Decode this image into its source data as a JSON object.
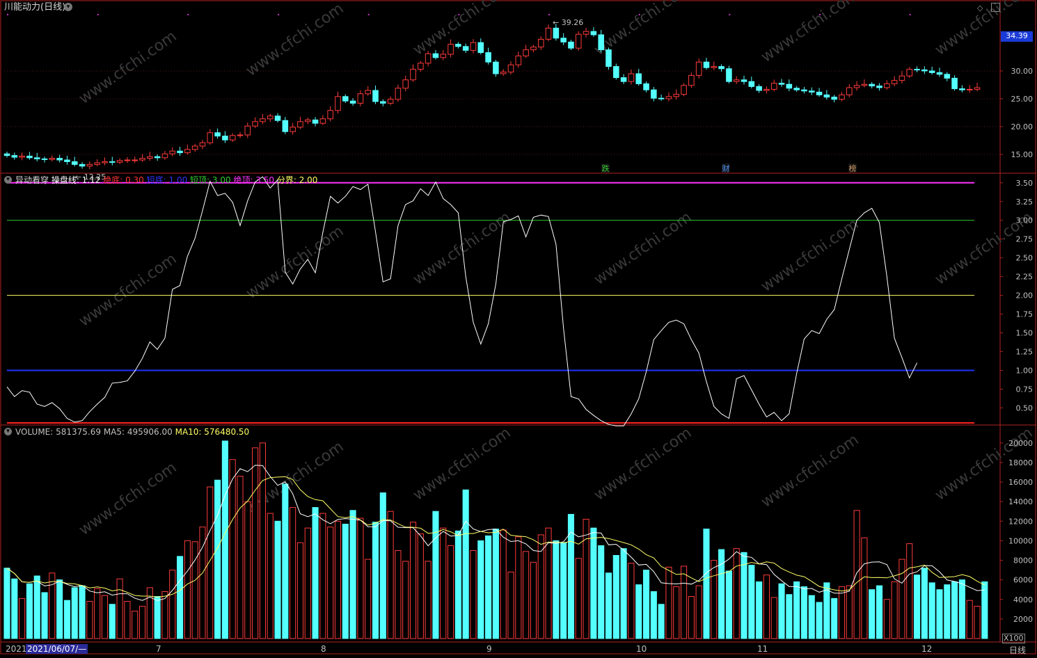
{
  "header": {
    "title": "川能动力(日线)",
    "current_price_tag": "34.39",
    "right_icons": [
      "diamond-icon",
      "restore-window-icon"
    ]
  },
  "price_panel": {
    "high_label": "39.26",
    "low_label": "12.25",
    "y_ticks": [
      "30.00",
      "25.00",
      "20.00",
      "15.00"
    ],
    "markers": [
      {
        "text": "跌",
        "color": "#33cc33"
      },
      {
        "text": "财",
        "color": "#5599ff"
      },
      {
        "text": "榜",
        "color": "#cc9966"
      }
    ]
  },
  "indicator_panel": {
    "name": "异动看穿",
    "params": [
      {
        "label": "操盘线: 1.12",
        "color": "#ffffff"
      },
      {
        "label": "绝底: 0.30",
        "color": "#ff3333"
      },
      {
        "label": "短底: 1.00",
        "color": "#3333ff"
      },
      {
        "label": "短顶: 3.00",
        "color": "#33cc33"
      },
      {
        "label": "绝顶: 3.50",
        "color": "#ff33ff"
      },
      {
        "label": "分界: 2.00",
        "color": "#ffff66"
      }
    ],
    "y_ticks": [
      "3.50",
      "3.25",
      "3.00",
      "2.75",
      "2.50",
      "2.25",
      "2.00",
      "1.75",
      "1.50",
      "1.25",
      "1.00",
      "0.75",
      "0.50"
    ]
  },
  "volume_panel": {
    "labels": [
      {
        "label": "VOLUME: 581375.69",
        "color": "#c0c0c0"
      },
      {
        "label": "MA5: 495906.00",
        "color": "#c0c0c0"
      },
      {
        "label": "MA10: 576480.50",
        "color": "#ffff66"
      }
    ],
    "y_ticks": [
      "20000",
      "18000",
      "16000",
      "14000",
      "12000",
      "10000",
      "8000",
      "6000",
      "4000",
      "2000"
    ],
    "unit": "X100"
  },
  "x_axis": {
    "labels": [
      "2021",
      "2021/06/07/—",
      "7",
      "8",
      "9",
      "10",
      "11",
      "12"
    ],
    "period": "日线"
  },
  "watermark": "www.cfchi.com",
  "colors": {
    "up": "#ff3b3b",
    "down": "#54ffff",
    "frame": "#b22222",
    "bg": "#000000"
  },
  "chart_data": [
    {
      "type": "candlestick",
      "title": "川能动力(日线)",
      "ylim": [
        12,
        40
      ],
      "series": [
        {
          "name": "close",
          "values": [
            14.8,
            14.5,
            14.7,
            14.4,
            14.2,
            14.1,
            14.3,
            14.0,
            13.7,
            13.2,
            12.9,
            13.2,
            13.5,
            13.7,
            13.6,
            13.9,
            14.0,
            14.0,
            14.3,
            14.6,
            14.4,
            15.1,
            15.6,
            15.3,
            15.9,
            16.5,
            17.1,
            18.9,
            18.3,
            17.6,
            18.4,
            18.5,
            20.1,
            20.9,
            21.4,
            21.9,
            21.1,
            19.1,
            19.9,
            20.9,
            21.2,
            20.6,
            21.4,
            22.9,
            25.4,
            24.6,
            24.2,
            25.9,
            26.5,
            24.5,
            24.2,
            24.9,
            26.9,
            28.4,
            30.3,
            31.4,
            33.1,
            32.4,
            33.0,
            34.8,
            34.4,
            33.7,
            35.1,
            33.3,
            31.6,
            29.5,
            29.8,
            31.1,
            32.7,
            33.8,
            34.3,
            35.7,
            37.7,
            35.9,
            35.2,
            34.1,
            36.6,
            37.1,
            36.5,
            33.8,
            30.8,
            28.8,
            28.1,
            29.5,
            27.7,
            26.6,
            25.1,
            25.0,
            25.4,
            25.8,
            27.4,
            29.2,
            31.6,
            30.6,
            30.8,
            30.4,
            28.1,
            28.4,
            28.1,
            27.2,
            26.5,
            26.7,
            27.8,
            27.6,
            26.9,
            26.6,
            26.4,
            26.2,
            25.7,
            25.3,
            24.9,
            25.7,
            27.0,
            27.4,
            27.6,
            27.3,
            27.0,
            27.7,
            28.3,
            29.1,
            30.3,
            30.2,
            30.0,
            29.7,
            29.4,
            28.7,
            26.8,
            26.6,
            26.7,
            27.0
          ]
        }
      ]
    },
    {
      "type": "line",
      "title": "异动看穿",
      "ylim": [
        0.3,
        3.6
      ],
      "series": [
        {
          "name": "操盘线",
          "values": [
            0.78,
            0.65,
            0.73,
            0.71,
            0.55,
            0.52,
            0.57,
            0.49,
            0.36,
            0.31,
            0.33,
            0.45,
            0.55,
            0.64,
            0.83,
            0.84,
            0.86,
            0.99,
            1.16,
            1.38,
            1.28,
            1.43,
            2.08,
            2.13,
            2.52,
            2.76,
            3.13,
            3.52,
            3.33,
            3.36,
            3.24,
            2.93,
            3.26,
            3.51,
            3.58,
            3.43,
            3.54,
            2.31,
            2.15,
            2.35,
            2.48,
            2.3,
            2.84,
            3.32,
            3.23,
            3.32,
            3.45,
            3.41,
            3.48,
            2.85,
            2.18,
            2.22,
            2.93,
            3.21,
            3.26,
            3.42,
            3.33,
            3.51,
            3.29,
            3.21,
            3.1,
            2.25,
            1.64,
            1.35,
            1.62,
            2.15,
            2.98,
            3.01,
            3.06,
            2.78,
            3.04,
            3.07,
            3.05,
            2.68,
            1.56,
            0.65,
            0.62,
            0.48,
            0.4,
            0.33,
            0.28,
            0.26,
            0.26,
            0.42,
            0.62,
            0.98,
            1.41,
            1.53,
            1.64,
            1.67,
            1.62,
            1.41,
            1.23,
            0.85,
            0.52,
            0.42,
            0.36,
            0.89,
            0.93,
            0.74,
            0.55,
            0.38,
            0.44,
            0.33,
            0.42,
            0.96,
            1.42,
            1.53,
            1.49,
            1.68,
            1.81,
            2.22,
            2.61,
            3.0,
            3.1,
            3.16,
            2.97,
            2.25,
            1.43,
            1.17,
            0.9,
            1.1
          ]
        },
        {
          "name": "绝底",
          "values": [
            0.3
          ]
        },
        {
          "name": "短底",
          "values": [
            1.0
          ]
        },
        {
          "name": "短顶",
          "values": [
            3.0
          ]
        },
        {
          "name": "绝顶",
          "values": [
            3.5
          ]
        },
        {
          "name": "分界",
          "values": [
            2.0
          ]
        }
      ]
    },
    {
      "type": "bar",
      "title": "VOLUME",
      "ylim": [
        0,
        20000
      ],
      "series": [
        {
          "name": "VOLUME",
          "values": [
            7200,
            6100,
            4100,
            5600,
            6400,
            4700,
            6700,
            6000,
            3900,
            5200,
            5400,
            3800,
            5100,
            4400,
            3500,
            6100,
            3800,
            2800,
            3300,
            5200,
            4300,
            4800,
            7000,
            8400,
            10000,
            9900,
            11400,
            15500,
            16200,
            20200,
            18300,
            16600,
            14000,
            19500,
            20000,
            12800,
            12000,
            15800,
            13400,
            9800,
            11300,
            13400,
            12800,
            11400,
            12000,
            11700,
            13100,
            12300,
            8100,
            11900,
            14900,
            13000,
            9000,
            7900,
            11900,
            10700,
            7900,
            13000,
            11300,
            9500,
            11000,
            15200,
            9000,
            10000,
            10500,
            11200,
            11100,
            6800,
            10400,
            8900,
            7800,
            10600,
            11300,
            10000,
            9800,
            12700,
            8200,
            12200,
            11300,
            9500,
            6700,
            8500,
            9200,
            7700,
            5500,
            7000,
            4800,
            3500,
            7300,
            5300,
            7400,
            4300,
            5400,
            11200,
            8000,
            9100,
            6900,
            9200,
            8800,
            7500,
            5800,
            6500,
            4200,
            5600,
            4500,
            5800,
            5300,
            4400,
            3700,
            5700,
            4100,
            5300,
            5400,
            13100,
            10300,
            5000,
            5400,
            4000,
            5800,
            8100,
            9700,
            6500,
            7200,
            5700,
            5000,
            5500,
            5800,
            6000,
            3900,
            3300,
            5800
          ]
        },
        {
          "name": "MA5",
          "values": []
        },
        {
          "name": "MA10",
          "values": []
        }
      ]
    }
  ]
}
